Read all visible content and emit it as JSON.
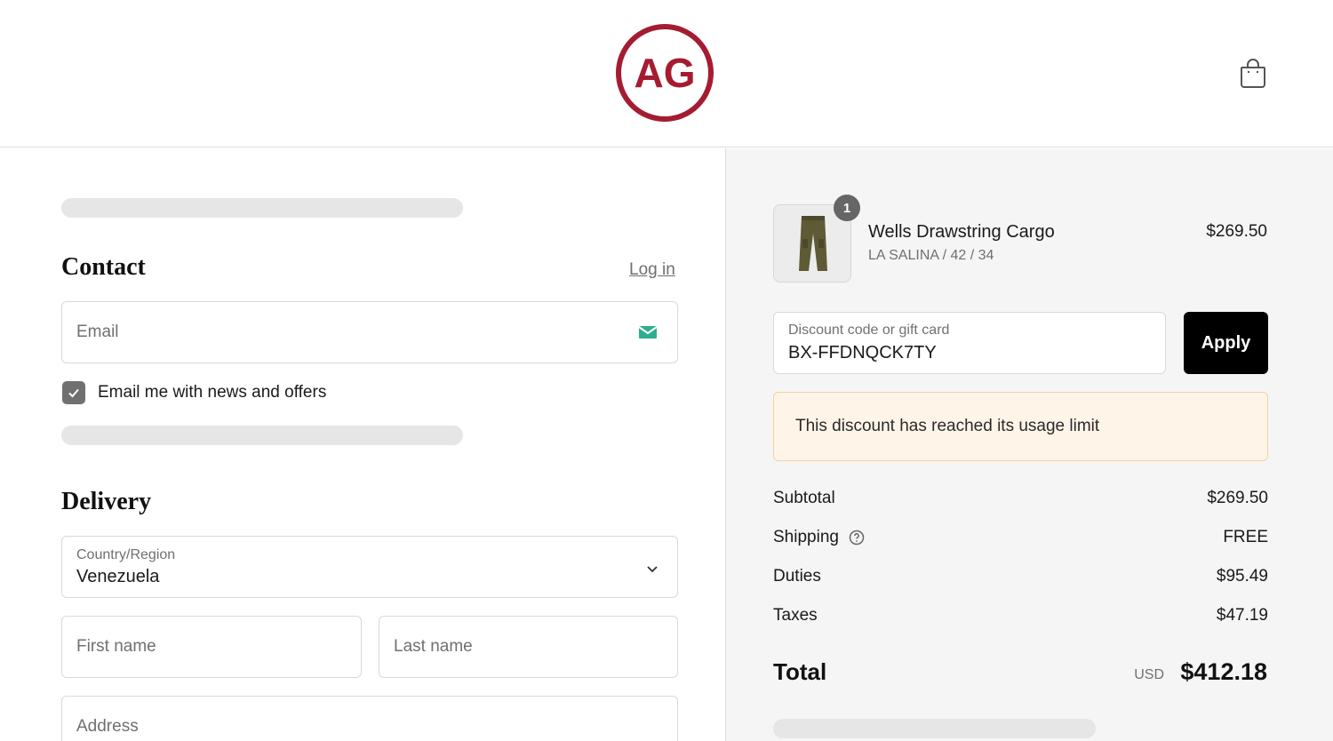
{
  "brand": {
    "logo_text": "AG",
    "logo_color": "#a51c30"
  },
  "header": {
    "cart_icon": "shopping-bag-icon"
  },
  "contact": {
    "title": "Contact",
    "login_label": "Log in",
    "email_placeholder": "Email",
    "newsletter_label": "Email me with news and offers",
    "newsletter_checked": true
  },
  "delivery": {
    "title": "Delivery",
    "country_label": "Country/Region",
    "country_value": "Venezuela",
    "first_name_placeholder": "First name",
    "last_name_placeholder": "Last name",
    "address_placeholder": "Address"
  },
  "order": {
    "product": {
      "quantity": "1",
      "name": "Wells Drawstring Cargo",
      "variant": "LA SALINA / 42 / 34",
      "price": "$269.50"
    },
    "discount": {
      "label": "Discount code or gift card",
      "value": "BX-FFDNQCK7TY",
      "apply_label": "Apply",
      "error": "This discount has reached its usage limit"
    },
    "summary": [
      {
        "label": "Subtotal",
        "value": "$269.50"
      },
      {
        "label": "Shipping",
        "value": "FREE"
      },
      {
        "label": "Duties",
        "value": "$95.49"
      },
      {
        "label": "Taxes",
        "value": "$47.19"
      }
    ],
    "total": {
      "label": "Total",
      "currency": "USD",
      "value": "$412.18"
    }
  }
}
